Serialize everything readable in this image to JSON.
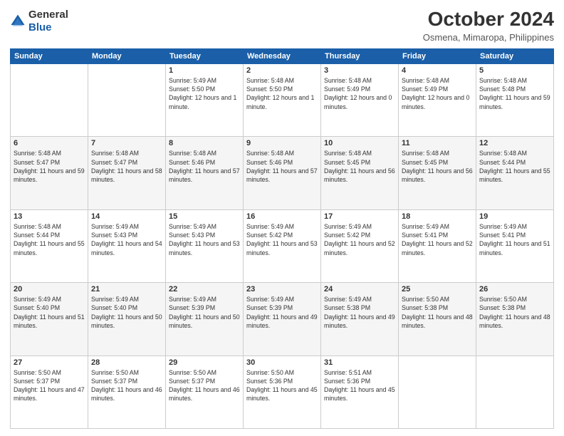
{
  "header": {
    "logo_general": "General",
    "logo_blue": "Blue",
    "month": "October 2024",
    "location": "Osmena, Mimaropa, Philippines"
  },
  "days_of_week": [
    "Sunday",
    "Monday",
    "Tuesday",
    "Wednesday",
    "Thursday",
    "Friday",
    "Saturday"
  ],
  "weeks": [
    [
      {
        "day": "",
        "sunrise": "",
        "sunset": "",
        "daylight": ""
      },
      {
        "day": "",
        "sunrise": "",
        "sunset": "",
        "daylight": ""
      },
      {
        "day": "1",
        "sunrise": "Sunrise: 5:49 AM",
        "sunset": "Sunset: 5:50 PM",
        "daylight": "Daylight: 12 hours and 1 minute."
      },
      {
        "day": "2",
        "sunrise": "Sunrise: 5:48 AM",
        "sunset": "Sunset: 5:50 PM",
        "daylight": "Daylight: 12 hours and 1 minute."
      },
      {
        "day": "3",
        "sunrise": "Sunrise: 5:48 AM",
        "sunset": "Sunset: 5:49 PM",
        "daylight": "Daylight: 12 hours and 0 minutes."
      },
      {
        "day": "4",
        "sunrise": "Sunrise: 5:48 AM",
        "sunset": "Sunset: 5:49 PM",
        "daylight": "Daylight: 12 hours and 0 minutes."
      },
      {
        "day": "5",
        "sunrise": "Sunrise: 5:48 AM",
        "sunset": "Sunset: 5:48 PM",
        "daylight": "Daylight: 11 hours and 59 minutes."
      }
    ],
    [
      {
        "day": "6",
        "sunrise": "Sunrise: 5:48 AM",
        "sunset": "Sunset: 5:47 PM",
        "daylight": "Daylight: 11 hours and 59 minutes."
      },
      {
        "day": "7",
        "sunrise": "Sunrise: 5:48 AM",
        "sunset": "Sunset: 5:47 PM",
        "daylight": "Daylight: 11 hours and 58 minutes."
      },
      {
        "day": "8",
        "sunrise": "Sunrise: 5:48 AM",
        "sunset": "Sunset: 5:46 PM",
        "daylight": "Daylight: 11 hours and 57 minutes."
      },
      {
        "day": "9",
        "sunrise": "Sunrise: 5:48 AM",
        "sunset": "Sunset: 5:46 PM",
        "daylight": "Daylight: 11 hours and 57 minutes."
      },
      {
        "day": "10",
        "sunrise": "Sunrise: 5:48 AM",
        "sunset": "Sunset: 5:45 PM",
        "daylight": "Daylight: 11 hours and 56 minutes."
      },
      {
        "day": "11",
        "sunrise": "Sunrise: 5:48 AM",
        "sunset": "Sunset: 5:45 PM",
        "daylight": "Daylight: 11 hours and 56 minutes."
      },
      {
        "day": "12",
        "sunrise": "Sunrise: 5:48 AM",
        "sunset": "Sunset: 5:44 PM",
        "daylight": "Daylight: 11 hours and 55 minutes."
      }
    ],
    [
      {
        "day": "13",
        "sunrise": "Sunrise: 5:48 AM",
        "sunset": "Sunset: 5:44 PM",
        "daylight": "Daylight: 11 hours and 55 minutes."
      },
      {
        "day": "14",
        "sunrise": "Sunrise: 5:49 AM",
        "sunset": "Sunset: 5:43 PM",
        "daylight": "Daylight: 11 hours and 54 minutes."
      },
      {
        "day": "15",
        "sunrise": "Sunrise: 5:49 AM",
        "sunset": "Sunset: 5:43 PM",
        "daylight": "Daylight: 11 hours and 53 minutes."
      },
      {
        "day": "16",
        "sunrise": "Sunrise: 5:49 AM",
        "sunset": "Sunset: 5:42 PM",
        "daylight": "Daylight: 11 hours and 53 minutes."
      },
      {
        "day": "17",
        "sunrise": "Sunrise: 5:49 AM",
        "sunset": "Sunset: 5:42 PM",
        "daylight": "Daylight: 11 hours and 52 minutes."
      },
      {
        "day": "18",
        "sunrise": "Sunrise: 5:49 AM",
        "sunset": "Sunset: 5:41 PM",
        "daylight": "Daylight: 11 hours and 52 minutes."
      },
      {
        "day": "19",
        "sunrise": "Sunrise: 5:49 AM",
        "sunset": "Sunset: 5:41 PM",
        "daylight": "Daylight: 11 hours and 51 minutes."
      }
    ],
    [
      {
        "day": "20",
        "sunrise": "Sunrise: 5:49 AM",
        "sunset": "Sunset: 5:40 PM",
        "daylight": "Daylight: 11 hours and 51 minutes."
      },
      {
        "day": "21",
        "sunrise": "Sunrise: 5:49 AM",
        "sunset": "Sunset: 5:40 PM",
        "daylight": "Daylight: 11 hours and 50 minutes."
      },
      {
        "day": "22",
        "sunrise": "Sunrise: 5:49 AM",
        "sunset": "Sunset: 5:39 PM",
        "daylight": "Daylight: 11 hours and 50 minutes."
      },
      {
        "day": "23",
        "sunrise": "Sunrise: 5:49 AM",
        "sunset": "Sunset: 5:39 PM",
        "daylight": "Daylight: 11 hours and 49 minutes."
      },
      {
        "day": "24",
        "sunrise": "Sunrise: 5:49 AM",
        "sunset": "Sunset: 5:38 PM",
        "daylight": "Daylight: 11 hours and 49 minutes."
      },
      {
        "day": "25",
        "sunrise": "Sunrise: 5:50 AM",
        "sunset": "Sunset: 5:38 PM",
        "daylight": "Daylight: 11 hours and 48 minutes."
      },
      {
        "day": "26",
        "sunrise": "Sunrise: 5:50 AM",
        "sunset": "Sunset: 5:38 PM",
        "daylight": "Daylight: 11 hours and 48 minutes."
      }
    ],
    [
      {
        "day": "27",
        "sunrise": "Sunrise: 5:50 AM",
        "sunset": "Sunset: 5:37 PM",
        "daylight": "Daylight: 11 hours and 47 minutes."
      },
      {
        "day": "28",
        "sunrise": "Sunrise: 5:50 AM",
        "sunset": "Sunset: 5:37 PM",
        "daylight": "Daylight: 11 hours and 46 minutes."
      },
      {
        "day": "29",
        "sunrise": "Sunrise: 5:50 AM",
        "sunset": "Sunset: 5:37 PM",
        "daylight": "Daylight: 11 hours and 46 minutes."
      },
      {
        "day": "30",
        "sunrise": "Sunrise: 5:50 AM",
        "sunset": "Sunset: 5:36 PM",
        "daylight": "Daylight: 11 hours and 45 minutes."
      },
      {
        "day": "31",
        "sunrise": "Sunrise: 5:51 AM",
        "sunset": "Sunset: 5:36 PM",
        "daylight": "Daylight: 11 hours and 45 minutes."
      },
      {
        "day": "",
        "sunrise": "",
        "sunset": "",
        "daylight": ""
      },
      {
        "day": "",
        "sunrise": "",
        "sunset": "",
        "daylight": ""
      }
    ]
  ]
}
